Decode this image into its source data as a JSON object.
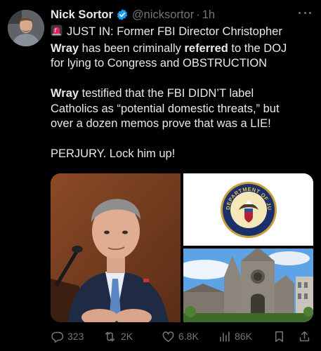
{
  "tweet": {
    "author_name": "Nick Sortor",
    "handle": "@nicksortor",
    "separator": "·",
    "time": "1h",
    "text": {
      "l1_intro": "JUST IN: Former FBI Director Christopher",
      "l2_b1": "Wray",
      "l2_t1": " has been criminally ",
      "l2_b2": "referred",
      "l2_t2": " to the DOJ",
      "l3": "for lying to Congress and OBSTRUCTION",
      "p2_b": "Wray",
      "p2_t": " testified that the FBI DIDN’T label",
      "p2_l2": "Catholics as “potential domestic threats,” but",
      "p2_l3": "over a dozen memos prove that was a LIE!",
      "p3": "PERJURY. Lock him up!"
    }
  },
  "seal": {
    "text": "DEPARTMENT OF JUSTICE"
  },
  "actions": {
    "replies": "323",
    "reposts": "2K",
    "likes": "6.8K",
    "views": "86K"
  },
  "colors": {
    "background": "#000000",
    "text": "#e7e9ea",
    "muted": "#71767b",
    "verified": "#1d9bf0",
    "siren": "#e0245e"
  },
  "icons": [
    "verified-badge-icon",
    "more-icon",
    "siren-emoji-icon",
    "reply-icon",
    "repost-icon",
    "like-icon",
    "views-icon",
    "bookmark-icon",
    "share-icon"
  ]
}
